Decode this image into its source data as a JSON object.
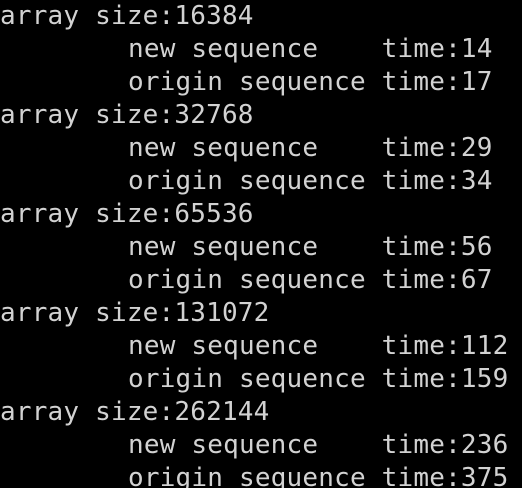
{
  "console": {
    "background": "#000000",
    "text_color": "#d2d2d2",
    "lines": [
      "array size:16384",
      "new sequence    time:14",
      "origin sequence time:17",
      "array size:32768",
      "new sequence    time:29",
      "origin sequence time:34",
      "array size:65536",
      "new sequence    time:56",
      "origin sequence time:67",
      "array size:131072",
      "new sequence    time:112",
      "origin sequence time:159",
      "array size:262144",
      "new sequence    time:236",
      "origin sequence time:375"
    ]
  }
}
